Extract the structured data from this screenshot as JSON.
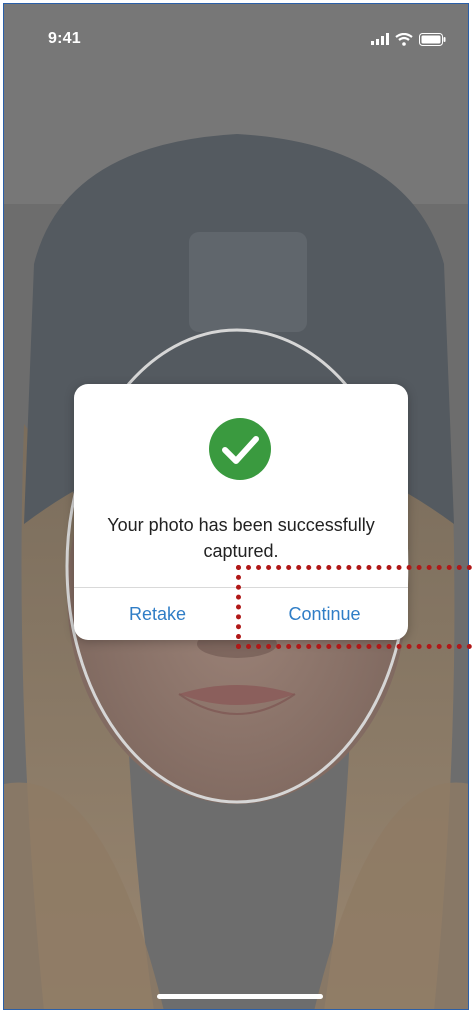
{
  "status_bar": {
    "time": "9:41",
    "icons": [
      "signal-icon",
      "wifi-icon",
      "battery-icon"
    ]
  },
  "dialog": {
    "icon": "checkmark-circle-icon",
    "message": "Your photo has been successfully captured.",
    "retake_label": "Retake",
    "continue_label": "Continue"
  },
  "colors": {
    "success_green": "#3a9a3f",
    "action_blue": "#2f7dc6",
    "highlight_red": "#b01818"
  }
}
